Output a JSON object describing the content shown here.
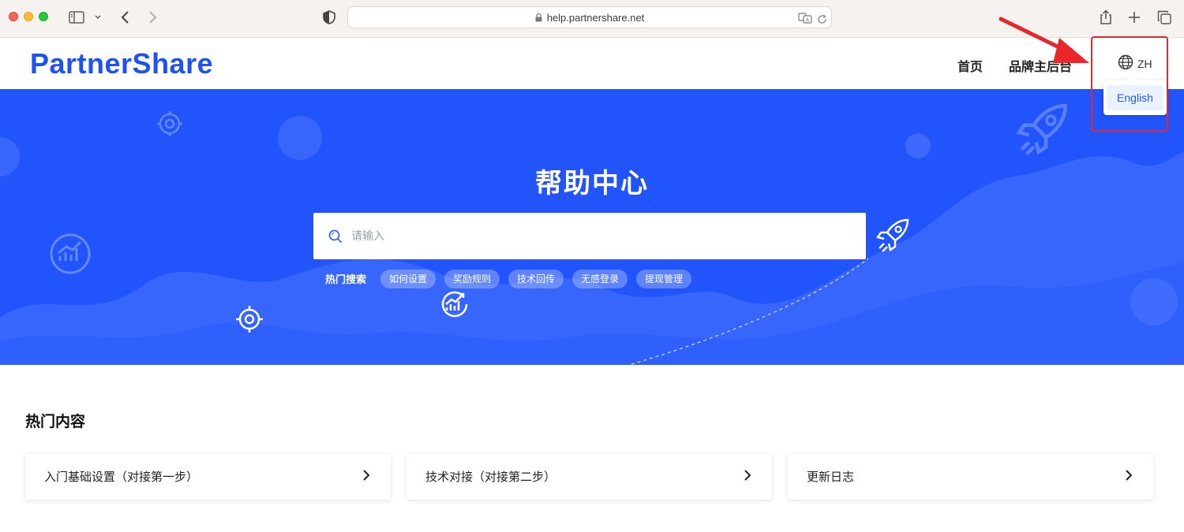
{
  "browser": {
    "url": "help.partnershare.net"
  },
  "header": {
    "logo": "PartnerShare",
    "nav": [
      {
        "label": "首页"
      },
      {
        "label": "品牌主后台"
      }
    ],
    "language": {
      "current": "ZH",
      "options": [
        "English"
      ]
    }
  },
  "hero": {
    "title": "帮助中心",
    "search": {
      "placeholder": "请输入",
      "value": ""
    },
    "hot_label": "热门搜索",
    "hot_tags": [
      "如何设置",
      "奖励规则",
      "技术回传",
      "无感登录",
      "提现管理"
    ]
  },
  "content": {
    "section_title": "热门内容",
    "cards": [
      {
        "label": "入门基础设置（对接第一步）"
      },
      {
        "label": "技术对接（对接第二步）"
      },
      {
        "label": "更新日志"
      }
    ]
  },
  "colors": {
    "brand": "#1f52f5",
    "hero_bg": "#2254fb",
    "annotation": "#e8262b"
  },
  "icons": [
    "sidebar-icon",
    "chevron-down-icon",
    "back-icon",
    "forward-icon",
    "shield-icon",
    "lock-icon",
    "translate-icon",
    "reload-icon",
    "share-icon",
    "plus-icon",
    "tabs-icon",
    "globe-icon",
    "search-icon",
    "chevron-right-icon",
    "rocket-icon",
    "target-icon",
    "growth-chart-icon"
  ]
}
